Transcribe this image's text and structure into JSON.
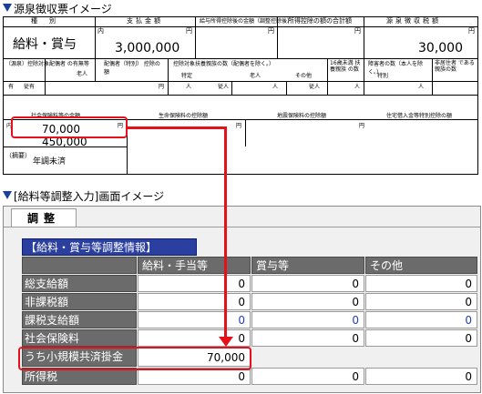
{
  "headings": {
    "slip": "▼源泉徴収票イメージ",
    "screen": "▼[給料等調整入力]画面イメージ"
  },
  "slip": {
    "col_kind": "種　別",
    "col_payment": "支払金額",
    "col_after_deduction": "給与所得控除後の金額（調整控除後）",
    "col_deduction_total": "所得控除の額の合計額",
    "col_tax": "源泉徴収税額",
    "kind_value": "給料・賞与",
    "payment_unit": "内",
    "payment_value": "3,000,000",
    "yen": "円",
    "tax_value": "30,000",
    "spouse_label": "（源泉）控除対象配偶者 の有無等",
    "spouse_sub": "老人",
    "spouse_ded": "配偶者（特別） 控除の額",
    "dependents": "控除対象扶養親族の数（配偶者を除く。）",
    "specific": "特定",
    "elderly": "老人",
    "other": "その他",
    "under16": "16歳未満 扶養親族 の数",
    "disabled": "障害者の数（本人を除く。）",
    "special": "特別",
    "nonres": "非居住者 である 親族の数",
    "have": "有",
    "subordinate": "従有",
    "person": "人",
    "jyu": "従人",
    "social_ins_label": "社会保険料等の金額",
    "life_ins_label": "生命保険料の控除額",
    "quake_ins_label": "地震保険料の控除額",
    "loan_label": "住宅借入金等特別控除の額",
    "social_inner": "内",
    "social_inner_value": "70,000",
    "social_value": "450,000",
    "summary": "（摘要）",
    "summary_value": "年調未済"
  },
  "screen": {
    "tab_label": "調整",
    "section_label": "【給料・賞与等調整情報】",
    "columns": [
      "給料・手当等",
      "賞与等",
      "その他"
    ],
    "rows": [
      {
        "label": "総支給額",
        "values": [
          "0",
          "0",
          "0"
        ]
      },
      {
        "label": "非課税額",
        "values": [
          "0",
          "0",
          "0"
        ]
      },
      {
        "label": "課税支給額",
        "values": [
          "0",
          "0",
          "0"
        ]
      },
      {
        "label": "社会保険料",
        "values": [
          "0",
          "0",
          "0"
        ]
      },
      {
        "label": "うち小規模共済掛金",
        "values": [
          "70,000"
        ]
      },
      {
        "label": "所得税",
        "values": [
          "0",
          "0",
          "0"
        ]
      }
    ]
  },
  "colors": {
    "highlight": "#e5101a",
    "section_bg": "#2a3f9f",
    "label_bg": "#6b6b6b",
    "blue_text": "#2040c0"
  }
}
